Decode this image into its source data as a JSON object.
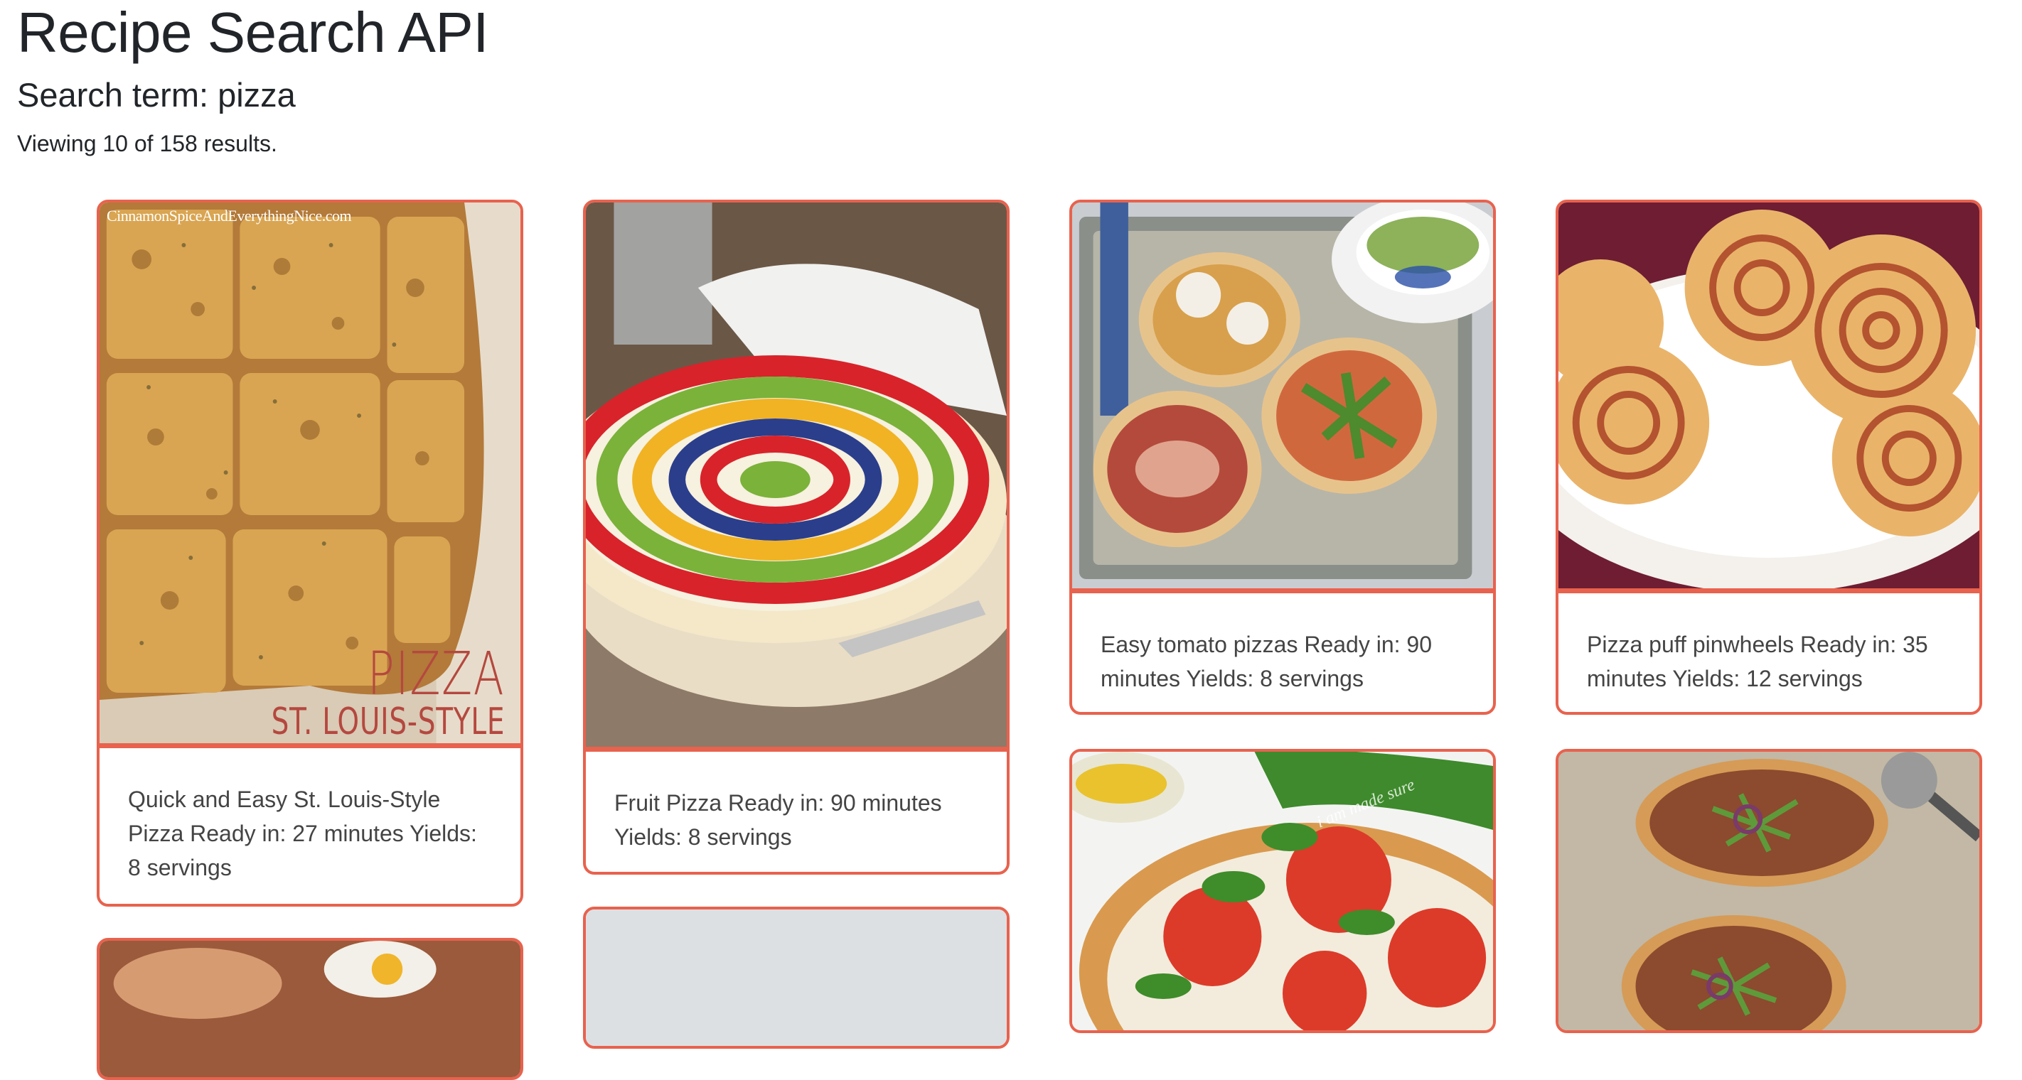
{
  "header": {
    "title": "Recipe Search API",
    "search_term": "Search term: pizza",
    "result_count": "Viewing 10 of 158 results."
  },
  "cards": [
    {
      "text": "Quick and Easy St. Louis-Style Pizza Ready in: 27 minutes Yields: 8 servings",
      "image_watermark": "CinnamonSpiceAndEverythingNice.com",
      "image_caption_line1": "PIZZA",
      "image_caption_line2": "ST. LOUIS-STYLE"
    },
    {
      "text": "Fruit Pizza Ready in: 90 minutes Yields: 8 servings"
    },
    {
      "text": "Easy tomato pizzas Ready in: 90 minutes Yields: 8 servings"
    },
    {
      "text": "Pizza puff pinwheels Ready in: 35 minutes Yields: 12 servings"
    },
    {
      "text": "",
      "image_signature": "i am made sure"
    },
    {
      "text": ""
    },
    {
      "text": ""
    },
    {
      "text": ""
    }
  ],
  "colors": {
    "card_border": "#e8624e",
    "text": "#212529",
    "card_text": "#444444"
  }
}
